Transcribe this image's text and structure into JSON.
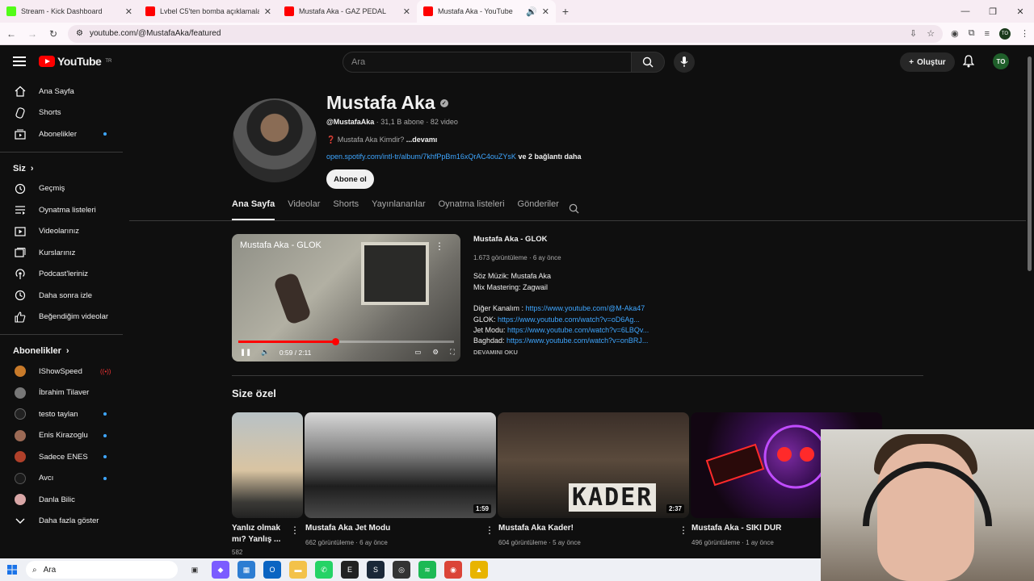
{
  "browser": {
    "tabs": [
      {
        "title": "Stream - Kick Dashboard",
        "color": "#53fc18"
      },
      {
        "title": "Lvbel C5'ten bomba açıklamala",
        "color": "#ff0000"
      },
      {
        "title": "Mustafa Aka - GAZ PEDAL",
        "color": "#ff0000"
      },
      {
        "title": "Mustafa Aka - YouTube",
        "color": "#ff0000"
      }
    ],
    "url": "youtube.com/@MustafaAka/featured",
    "profile_initials": "TO"
  },
  "header": {
    "logo_text": "YouTube",
    "logo_region": "TR",
    "search_placeholder": "Ara",
    "create_label": "Oluştur",
    "avatar_initials": "TO"
  },
  "sidebar": {
    "main": [
      "Ana Sayfa",
      "Shorts",
      "Abonelikler"
    ],
    "you_title": "Siz",
    "you_items": [
      "Geçmiş",
      "Oynatma listeleri",
      "Videolarınız",
      "Kurslarınız",
      "Podcast'leriniz",
      "Daha sonra izle",
      "Beğendiğim videolar"
    ],
    "subs_title": "Abonelikler",
    "subs": [
      {
        "name": "IShowSpeed",
        "live": true
      },
      {
        "name": "İbrahim Tilaver",
        "live": false
      },
      {
        "name": "testo taylan",
        "live": false
      },
      {
        "name": "Enis Kirazoglu",
        "live": false
      },
      {
        "name": "Sadece ENES",
        "live": false
      },
      {
        "name": "Avcı",
        "live": false
      },
      {
        "name": "Danla Bilic",
        "live": false
      }
    ],
    "show_more": "Daha fazla göster"
  },
  "channel": {
    "name": "Mustafa Aka",
    "handle": "@MustafaAka",
    "stats": " · 31,1 B abone · 82 video",
    "desc_prefix": "❓ Mustafa Aka Kimdir? ",
    "desc_more": "...devamı",
    "link": "open.spotify.com/intl-tr/album/7khfPpBm16xQrAC4ouZYsK",
    "link_more": " ve 2 bağlantı daha",
    "subscribe": "Abone ol",
    "tabs": [
      "Ana Sayfa",
      "Videolar",
      "Shorts",
      "Yayınlananlar",
      "Oynatma listeleri",
      "Gönderiler"
    ]
  },
  "featured": {
    "player_title": "Mustafa Aka - GLOK",
    "time": "0:59 / 2:11",
    "progress": 0.45,
    "title": "Mustafa Aka - GLOK",
    "meta": "1.673 görüntüleme · 6 ay önce",
    "lines": [
      {
        "label": "Söz Müzik: Mustafa Aka",
        "link": ""
      },
      {
        "label": "Mix Mastering: Zagwail",
        "link": ""
      },
      {
        "label": "Diğer Kanalım : ",
        "link": "https://www.youtube.com/@M-Aka47"
      },
      {
        "label": "GLOK: ",
        "link": "https://www.youtube.com/watch?v=oD6Ag..."
      },
      {
        "label": "Jet Modu: ",
        "link": "https://www.youtube.com/watch?v=6LBQv..."
      },
      {
        "label": "Baghdad: ",
        "link": "https://www.youtube.com/watch?v=onBRJ..."
      }
    ],
    "read_more": "DEVAMINI OKU"
  },
  "section": {
    "title": "Size özel",
    "videos": [
      {
        "title1": "Yanlız olmak",
        "title2": "mı? Yanlış ...",
        "meta": "582",
        "duration": ""
      },
      {
        "title1": "Mustafa Aka Jet Modu",
        "title2": "",
        "meta": "662 görüntüleme · 6 ay önce",
        "duration": "1:59"
      },
      {
        "title1": "Mustafa Aka Kader!",
        "title2": "",
        "meta": "604 görüntüleme · 5 ay önce",
        "duration": "2:37",
        "overlay": "KADER"
      },
      {
        "title1": "Mustafa Aka - SIKI DUR",
        "title2": "",
        "meta": "496 görüntüleme · 1 ay önce",
        "duration": ""
      }
    ]
  },
  "taskbar": {
    "search": "Ara"
  }
}
